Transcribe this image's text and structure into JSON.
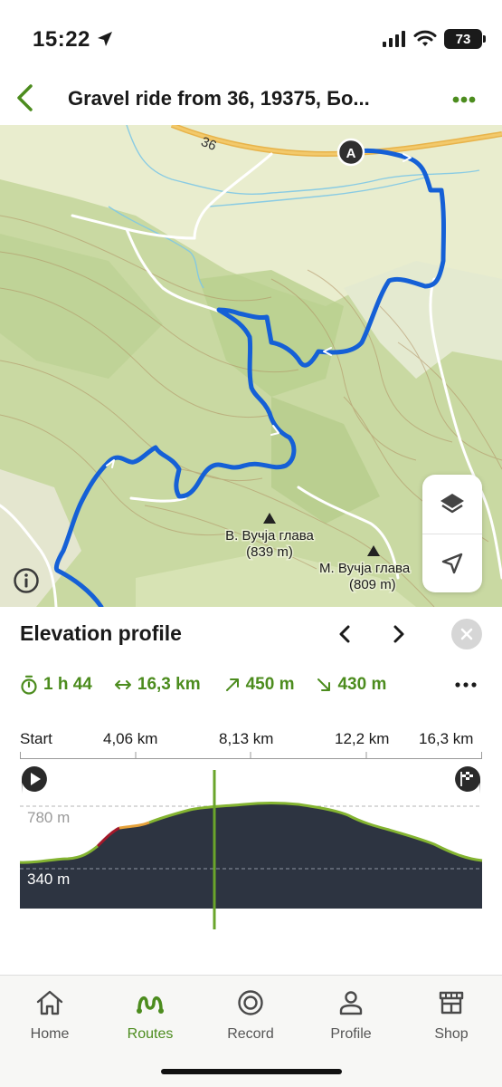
{
  "status_bar": {
    "time": "15:22",
    "battery": "73"
  },
  "header": {
    "title": "Gravel ride from 36, 19375, Бо..."
  },
  "map": {
    "road_number": "36",
    "start_marker": "A",
    "peaks": [
      {
        "name": "В. Вучја глава",
        "elevation": "(839 m)"
      },
      {
        "name": "М. Вучја глава",
        "elevation": "(809 m)"
      }
    ],
    "route_color": "#1560d6"
  },
  "elevation_panel": {
    "title": "Elevation profile",
    "stats": {
      "duration": "1 h 44",
      "distance": "16,3 km",
      "ascent": "450 m",
      "descent": "430 m"
    },
    "km_labels": [
      "Start",
      "4,06 km",
      "8,13 km",
      "12,2 km",
      "16,3 km"
    ],
    "elevation_labels": {
      "top": "780 m",
      "bottom": "340 m"
    },
    "cursor_fraction": 0.42,
    "accent_color": "#4c8c1e"
  },
  "tabbar": {
    "tabs": [
      {
        "label": "Home",
        "icon": "home-icon"
      },
      {
        "label": "Routes",
        "icon": "routes-icon",
        "active": true
      },
      {
        "label": "Record",
        "icon": "record-icon"
      },
      {
        "label": "Profile",
        "icon": "profile-icon"
      },
      {
        "label": "Shop",
        "icon": "shop-icon"
      }
    ]
  }
}
